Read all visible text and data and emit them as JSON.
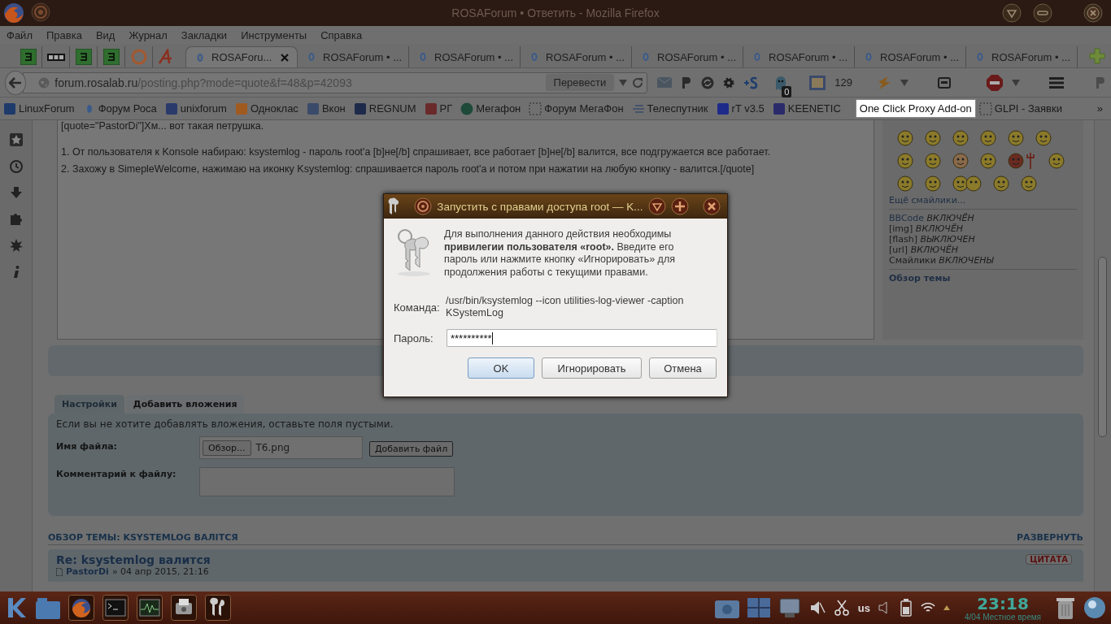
{
  "window": {
    "title": "ROSAForum • Ответить - Mozilla Firefox"
  },
  "menu": [
    "Файл",
    "Правка",
    "Вид",
    "Журнал",
    "Закладки",
    "Инструменты",
    "Справка"
  ],
  "tabs": [
    {
      "label": "ROSAForu...",
      "selected": true
    },
    {
      "label": "ROSAForum • ...",
      "selected": false
    },
    {
      "label": "ROSAForum • ...",
      "selected": false
    },
    {
      "label": "ROSAForum • ...",
      "selected": false
    },
    {
      "label": "ROSAForum • ...",
      "selected": false
    },
    {
      "label": "ROSAForum • ...",
      "selected": false
    },
    {
      "label": "ROSAForum • ...",
      "selected": false
    },
    {
      "label": "ROSAForum • ...",
      "selected": false
    }
  ],
  "address_bar": {
    "host": "forum.rosalab.ru",
    "path": "/posting.php?mode=quote&f=48&p=42093",
    "translate_button": "Перевести"
  },
  "toolbar": {
    "badge": "0",
    "counter": "129"
  },
  "bookmarks": [
    "LinuxForum",
    "Форум Роса",
    "unixforum",
    "Одноклас",
    "Вкон",
    "REGNUM",
    "РГ",
    "Мегафон",
    "Форум МегаФон",
    "Телеспутник",
    "rT v3.5",
    "KEENETIC"
  ],
  "tooltip": "One Click Proxy Add-on",
  "bookmarks_after": [
    "GLPI - Заявки"
  ],
  "bookmarks_overflow": "»",
  "editor": {
    "lines": [
      "[quote=\"PastorDi\"]Хм... вот такая петрушка.",
      "1. От пользователя к Konsole набираю: ksystemlog - пароль root'a [b]не[/b] спрашивает, все работает [b]не[/b] валится, все подгружается все работает.",
      "2. Захожу в SimepleWelcome, нажимаю на иконку Ksystemlog: спрашивается пароль root'a и потом при нажатии на любую кнопку - валится.[/quote]"
    ]
  },
  "smilies_link": "Ещё смайлики...",
  "options": [
    {
      "label": "BBCode",
      "status": "ВКЛЮЧЁН"
    },
    {
      "label": "[img]",
      "status": "ВКЛЮЧЁН"
    },
    {
      "label": "[flash]",
      "status": "ВЫКЛЮЧЕН"
    },
    {
      "label": "[url]",
      "status": "ВКЛЮЧЁН"
    },
    {
      "label": "Смайлики",
      "status": "ВКЛЮЧЕНЫ"
    }
  ],
  "topic_review_link": "Обзор темы",
  "attach_tabs": [
    {
      "label": "Настройки",
      "selected": false
    },
    {
      "label": "Добавить вложения",
      "selected": true
    }
  ],
  "attach": {
    "hint": "Если вы не хотите добавлять вложения, оставьте поля пустыми.",
    "file_label": "Имя файла:",
    "browse_button": "Обзор...",
    "file_name": "T6.png",
    "add_button": "Добавить файл",
    "comment_label": "Комментарий к файлу:"
  },
  "topic_review": {
    "title": "ОБЗОР ТЕМЫ: KSYSTEMLOG ВАЛIТСЯ",
    "expand": "РАЗВЕРНУТЬ",
    "post_title": "Re: ksystemlog валится",
    "quote_button": "ЦИТАТА",
    "author": "PastorDi",
    "date": "» 04 апр 2015, 21:16"
  },
  "dialog": {
    "title": "Запустить с правами доступа root — K...",
    "message": "Для выполнения данного действия необходимы **привилегии пользователя «root».** Введите его пароль или нажмите кнопку «Игнорировать» для продолжения работы с текущими правами.",
    "command_label": "Команда:",
    "command": "/usr/bin/ksystemlog --icon utilities-log-viewer -caption KSystemLog",
    "password_label": "Пароль:",
    "password": "**********",
    "buttons": [
      {
        "label": "OK",
        "default": true
      },
      {
        "label": "Игнорировать",
        "default": false
      },
      {
        "label": "Отмена",
        "default": false
      }
    ]
  },
  "taskbar": {
    "layout": "us",
    "time": "23:18",
    "date": "4/04 Местное время"
  }
}
